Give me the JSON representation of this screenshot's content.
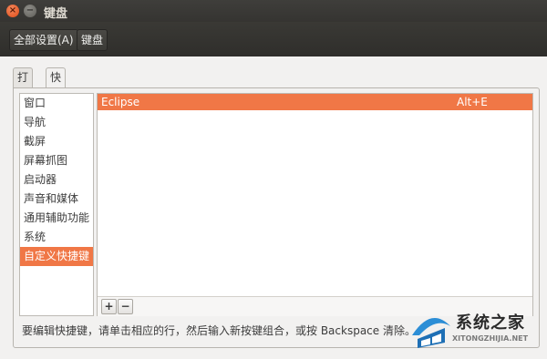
{
  "window": {
    "title": "键盘"
  },
  "breadcrumb": {
    "all_settings": "全部设置(A)",
    "current": "键盘"
  },
  "tabs": [
    {
      "label": "打字",
      "active": false
    },
    {
      "label": "快捷键",
      "active": true
    }
  ],
  "categories": [
    {
      "label": "窗口",
      "selected": false
    },
    {
      "label": "导航",
      "selected": false
    },
    {
      "label": "截屏",
      "selected": false
    },
    {
      "label": "屏幕抓图",
      "selected": false
    },
    {
      "label": "启动器",
      "selected": false
    },
    {
      "label": "声音和媒体",
      "selected": false
    },
    {
      "label": "通用辅助功能",
      "selected": false
    },
    {
      "label": "系统",
      "selected": false
    },
    {
      "label": "自定义快捷键",
      "selected": true
    }
  ],
  "shortcuts": [
    {
      "name": "Eclipse",
      "accel": "Alt+E",
      "selected": true
    }
  ],
  "list_toolbar": {
    "add": "+",
    "remove": "−"
  },
  "hint": "要编辑快捷键，请单击相应的行，然后输入新按键组合，或按 Backspace 清除。",
  "watermark": {
    "text": "系统之家",
    "sub": "XITONGZHIJIA.NET"
  },
  "colors": {
    "accent": "#f07746",
    "titlebar": "#3c3b37"
  }
}
